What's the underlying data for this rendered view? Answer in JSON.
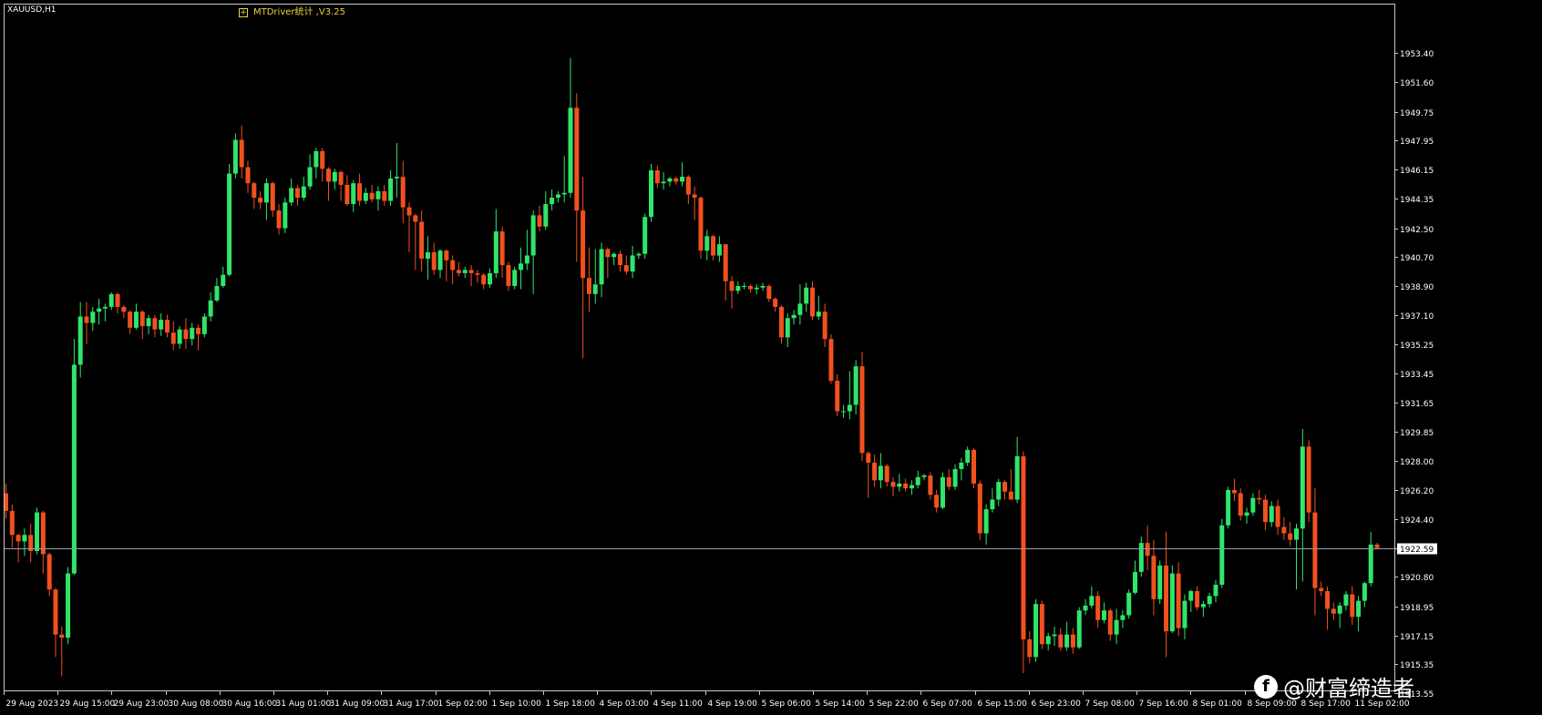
{
  "symbol_label": "XAUUSD,H1",
  "indicator_label": "MTDriver统计 ,V3.25",
  "indicator_toggle": "+",
  "watermark": {
    "logo": "f",
    "text": "@财富缔造者"
  },
  "colors": {
    "background": "#000000",
    "up": "#2fe66a",
    "down": "#f2501e",
    "price_line": "#8f9fb8",
    "frame": "#c8c8c8",
    "axis_text": "#ffffff"
  },
  "chart_data": {
    "type": "candlestick",
    "title": "XAUUSD,H1",
    "ylim": [
      1913.55,
      1954.95
    ],
    "y_ticks": [
      "1953.40",
      "1951.60",
      "1949.75",
      "1947.95",
      "1946.15",
      "1944.35",
      "1942.50",
      "1940.70",
      "1938.90",
      "1937.10",
      "1935.25",
      "1933.45",
      "1931.65",
      "1929.85",
      "1928.00",
      "1926.20",
      "1924.40",
      "1922.59",
      "1920.80",
      "1918.95",
      "1917.15",
      "1915.35",
      "1913.55"
    ],
    "x_ticks": [
      "29 Aug 2023",
      "29 Aug 15:00",
      "29 Aug 23:00",
      "30 Aug 08:00",
      "30 Aug 16:00",
      "31 Aug 01:00",
      "31 Aug 09:00",
      "31 Aug 17:00",
      "1 Sep 02:00",
      "1 Sep 10:00",
      "1 Sep 18:00",
      "4 Sep 03:00",
      "4 Sep 11:00",
      "4 Sep 19:00",
      "5 Sep 06:00",
      "5 Sep 14:00",
      "5 Sep 22:00",
      "6 Sep 07:00",
      "6 Sep 15:00",
      "6 Sep 23:00",
      "7 Sep 08:00",
      "7 Sep 16:00",
      "8 Sep 01:00",
      "8 Sep 09:00",
      "8 Sep 17:00",
      "11 Sep 02:00"
    ],
    "current_price": "1922.59",
    "grid": false,
    "ohlc": [
      [
        1926.0,
        1926.6,
        1924.4,
        1924.9
      ],
      [
        1924.9,
        1925.3,
        1922.6,
        1923.4
      ],
      [
        1923.4,
        1923.5,
        1921.7,
        1923.0
      ],
      [
        1923.0,
        1923.8,
        1922.1,
        1923.4
      ],
      [
        1923.4,
        1924.1,
        1921.7,
        1922.4
      ],
      [
        1922.4,
        1925.1,
        1922.2,
        1924.8
      ],
      [
        1924.8,
        1924.9,
        1921.0,
        1922.2
      ],
      [
        1922.2,
        1922.3,
        1919.6,
        1920.0
      ],
      [
        1920.0,
        1920.1,
        1915.8,
        1917.2
      ],
      [
        1917.2,
        1917.7,
        1914.6,
        1917.0
      ],
      [
        1917.0,
        1921.4,
        1916.6,
        1921.0
      ],
      [
        1921.0,
        1935.6,
        1920.9,
        1934.0
      ],
      [
        1934.0,
        1937.9,
        1933.2,
        1937.0
      ],
      [
        1937.0,
        1937.9,
        1935.3,
        1936.6
      ],
      [
        1936.6,
        1937.6,
        1936.1,
        1937.3
      ],
      [
        1937.3,
        1938.1,
        1936.5,
        1937.5
      ],
      [
        1937.5,
        1937.8,
        1936.7,
        1937.6
      ],
      [
        1937.6,
        1938.5,
        1937.4,
        1938.4
      ],
      [
        1938.4,
        1938.5,
        1937.2,
        1937.6
      ],
      [
        1937.6,
        1937.7,
        1936.9,
        1937.3
      ],
      [
        1937.3,
        1937.4,
        1935.9,
        1936.3
      ],
      [
        1936.3,
        1937.8,
        1936.2,
        1937.3
      ],
      [
        1937.3,
        1937.4,
        1935.6,
        1936.4
      ],
      [
        1936.4,
        1937.1,
        1935.9,
        1936.9
      ],
      [
        1936.9,
        1937.1,
        1935.7,
        1936.2
      ],
      [
        1936.2,
        1937.2,
        1935.8,
        1936.8
      ],
      [
        1936.8,
        1937.1,
        1935.7,
        1936.0
      ],
      [
        1936.0,
        1936.7,
        1934.9,
        1935.3
      ],
      [
        1935.3,
        1936.4,
        1935.0,
        1936.2
      ],
      [
        1936.2,
        1936.9,
        1935.0,
        1935.6
      ],
      [
        1935.6,
        1936.6,
        1935.2,
        1936.3
      ],
      [
        1936.3,
        1936.5,
        1934.9,
        1935.9
      ],
      [
        1935.9,
        1937.2,
        1935.7,
        1937.0
      ],
      [
        1937.0,
        1938.5,
        1936.7,
        1938.0
      ],
      [
        1938.0,
        1939.4,
        1937.9,
        1938.9
      ],
      [
        1938.9,
        1940.1,
        1938.8,
        1939.6
      ],
      [
        1939.6,
        1946.5,
        1939.5,
        1945.9
      ],
      [
        1945.9,
        1948.4,
        1945.6,
        1948.0
      ],
      [
        1948.0,
        1948.9,
        1945.6,
        1946.3
      ],
      [
        1946.3,
        1946.7,
        1944.7,
        1945.3
      ],
      [
        1945.3,
        1945.4,
        1943.7,
        1944.4
      ],
      [
        1944.4,
        1944.8,
        1943.7,
        1944.1
      ],
      [
        1944.1,
        1945.6,
        1943.0,
        1945.3
      ],
      [
        1945.3,
        1945.4,
        1943.2,
        1943.6
      ],
      [
        1943.6,
        1944.0,
        1942.1,
        1942.5
      ],
      [
        1942.5,
        1944.4,
        1942.2,
        1944.1
      ],
      [
        1944.1,
        1945.6,
        1943.9,
        1945.0
      ],
      [
        1945.0,
        1945.2,
        1943.9,
        1944.4
      ],
      [
        1944.4,
        1945.7,
        1944.2,
        1945.1
      ],
      [
        1945.1,
        1947.1,
        1944.9,
        1946.3
      ],
      [
        1946.3,
        1947.5,
        1945.6,
        1947.3
      ],
      [
        1947.3,
        1947.5,
        1945.4,
        1946.2
      ],
      [
        1946.2,
        1946.3,
        1944.2,
        1945.4
      ],
      [
        1945.4,
        1946.2,
        1944.9,
        1946.0
      ],
      [
        1946.0,
        1946.1,
        1944.2,
        1945.2
      ],
      [
        1945.2,
        1945.8,
        1943.9,
        1944.0
      ],
      [
        1944.0,
        1945.5,
        1943.5,
        1945.3
      ],
      [
        1945.3,
        1945.9,
        1943.9,
        1944.2
      ],
      [
        1944.2,
        1945.0,
        1944.0,
        1944.7
      ],
      [
        1944.7,
        1945.2,
        1944.1,
        1944.3
      ],
      [
        1944.3,
        1945.1,
        1943.6,
        1944.8
      ],
      [
        1944.8,
        1945.2,
        1943.9,
        1944.2
      ],
      [
        1944.2,
        1946.1,
        1943.9,
        1945.6
      ],
      [
        1945.6,
        1947.8,
        1944.4,
        1945.7
      ],
      [
        1945.7,
        1946.7,
        1942.8,
        1943.8
      ],
      [
        1943.8,
        1944.1,
        1941.0,
        1943.3
      ],
      [
        1943.3,
        1943.4,
        1939.9,
        1942.9
      ],
      [
        1942.9,
        1943.6,
        1939.8,
        1940.6
      ],
      [
        1940.6,
        1942.0,
        1939.3,
        1941.0
      ],
      [
        1941.0,
        1941.6,
        1939.6,
        1939.9
      ],
      [
        1939.9,
        1941.2,
        1939.4,
        1941.1
      ],
      [
        1941.1,
        1941.2,
        1939.2,
        1940.5
      ],
      [
        1940.5,
        1940.8,
        1939.0,
        1939.9
      ],
      [
        1939.9,
        1940.4,
        1939.5,
        1939.7
      ],
      [
        1939.7,
        1940.1,
        1939.4,
        1939.9
      ],
      [
        1939.9,
        1940.2,
        1938.9,
        1939.7
      ],
      [
        1939.7,
        1939.9,
        1939.1,
        1939.6
      ],
      [
        1939.6,
        1939.7,
        1938.7,
        1939.0
      ],
      [
        1939.0,
        1940.0,
        1938.8,
        1939.7
      ],
      [
        1939.7,
        1943.7,
        1939.4,
        1942.3
      ],
      [
        1942.3,
        1942.6,
        1939.4,
        1940.2
      ],
      [
        1940.2,
        1940.4,
        1938.6,
        1938.9
      ],
      [
        1938.9,
        1940.1,
        1938.7,
        1939.9
      ],
      [
        1939.9,
        1941.3,
        1938.7,
        1940.3
      ],
      [
        1940.3,
        1942.4,
        1939.9,
        1940.8
      ],
      [
        1940.8,
        1943.6,
        1938.4,
        1943.3
      ],
      [
        1943.3,
        1943.9,
        1942.3,
        1942.6
      ],
      [
        1942.6,
        1944.8,
        1942.4,
        1944.0
      ],
      [
        1944.0,
        1944.9,
        1943.6,
        1944.4
      ],
      [
        1944.4,
        1944.8,
        1944.1,
        1944.6
      ],
      [
        1944.6,
        1947.0,
        1944.1,
        1944.7
      ],
      [
        1944.7,
        1953.1,
        1944.4,
        1950.0
      ],
      [
        1950.0,
        1950.9,
        1940.4,
        1943.6
      ],
      [
        1943.6,
        1945.7,
        1934.4,
        1939.4
      ],
      [
        1939.4,
        1941.3,
        1937.3,
        1938.4
      ],
      [
        1938.4,
        1941.2,
        1937.8,
        1939.0
      ],
      [
        1939.0,
        1941.6,
        1938.2,
        1941.2
      ],
      [
        1941.2,
        1941.3,
        1939.4,
        1940.7
      ],
      [
        1940.7,
        1941.0,
        1940.2,
        1940.9
      ],
      [
        1940.9,
        1941.1,
        1939.8,
        1940.2
      ],
      [
        1940.2,
        1940.8,
        1939.6,
        1939.8
      ],
      [
        1939.8,
        1941.4,
        1939.4,
        1940.8
      ],
      [
        1940.8,
        1941.0,
        1940.6,
        1940.9
      ],
      [
        1940.9,
        1943.4,
        1940.6,
        1943.2
      ],
      [
        1943.2,
        1946.5,
        1942.9,
        1946.1
      ],
      [
        1946.1,
        1946.4,
        1945.0,
        1945.3
      ],
      [
        1945.3,
        1946.0,
        1944.9,
        1945.4
      ],
      [
        1945.4,
        1945.7,
        1945.1,
        1945.6
      ],
      [
        1945.6,
        1945.7,
        1945.2,
        1945.4
      ],
      [
        1945.4,
        1946.6,
        1945.1,
        1945.7
      ],
      [
        1945.7,
        1945.8,
        1944.0,
        1944.6
      ],
      [
        1944.6,
        1945.1,
        1943.0,
        1944.4
      ],
      [
        1944.4,
        1944.5,
        1940.6,
        1941.1
      ],
      [
        1941.1,
        1942.4,
        1940.5,
        1942.0
      ],
      [
        1942.0,
        1942.1,
        1940.5,
        1940.8
      ],
      [
        1940.8,
        1942.0,
        1940.4,
        1941.5
      ],
      [
        1941.5,
        1941.5,
        1938.0,
        1939.2
      ],
      [
        1939.2,
        1939.5,
        1937.5,
        1938.6
      ],
      [
        1938.6,
        1939.2,
        1938.4,
        1938.9
      ],
      [
        1938.9,
        1939.1,
        1938.7,
        1938.9
      ],
      [
        1938.9,
        1939.0,
        1938.5,
        1938.7
      ],
      [
        1938.7,
        1939.0,
        1938.4,
        1938.8
      ],
      [
        1938.8,
        1939.1,
        1938.6,
        1938.9
      ],
      [
        1938.9,
        1939.0,
        1937.9,
        1938.1
      ],
      [
        1938.1,
        1938.2,
        1937.3,
        1937.6
      ],
      [
        1937.6,
        1937.7,
        1935.3,
        1935.7
      ],
      [
        1935.7,
        1937.2,
        1935.1,
        1936.9
      ],
      [
        1936.9,
        1937.4,
        1936.5,
        1937.1
      ],
      [
        1937.1,
        1939.0,
        1936.5,
        1937.8
      ],
      [
        1937.8,
        1939.1,
        1937.3,
        1938.8
      ],
      [
        1938.8,
        1939.2,
        1936.8,
        1937.0
      ],
      [
        1937.0,
        1938.3,
        1936.8,
        1937.3
      ],
      [
        1937.3,
        1937.8,
        1935.1,
        1935.6
      ],
      [
        1935.6,
        1935.9,
        1932.8,
        1933.0
      ],
      [
        1933.0,
        1933.4,
        1930.8,
        1931.1
      ],
      [
        1931.1,
        1931.5,
        1930.7,
        1931.1
      ],
      [
        1931.1,
        1933.6,
        1930.6,
        1931.5
      ],
      [
        1931.5,
        1934.3,
        1930.9,
        1933.9
      ],
      [
        1933.9,
        1934.8,
        1928.0,
        1928.5
      ],
      [
        1928.5,
        1928.6,
        1925.7,
        1927.9
      ],
      [
        1927.9,
        1928.4,
        1926.4,
        1926.8
      ],
      [
        1926.8,
        1928.5,
        1926.3,
        1927.7
      ],
      [
        1927.7,
        1927.8,
        1926.4,
        1926.7
      ],
      [
        1926.7,
        1927.0,
        1925.8,
        1926.4
      ],
      [
        1926.4,
        1927.2,
        1926.1,
        1926.6
      ],
      [
        1926.6,
        1926.9,
        1926.1,
        1926.3
      ],
      [
        1926.3,
        1926.8,
        1925.9,
        1926.5
      ],
      [
        1926.5,
        1927.4,
        1926.3,
        1927.0
      ],
      [
        1927.0,
        1927.2,
        1926.8,
        1927.1
      ],
      [
        1927.1,
        1927.3,
        1925.6,
        1925.9
      ],
      [
        1925.9,
        1926.2,
        1924.8,
        1925.1
      ],
      [
        1925.1,
        1927.3,
        1925.0,
        1927.0
      ],
      [
        1927.0,
        1927.5,
        1926.2,
        1926.4
      ],
      [
        1926.4,
        1927.8,
        1926.2,
        1927.5
      ],
      [
        1927.5,
        1928.2,
        1926.8,
        1927.9
      ],
      [
        1927.9,
        1928.9,
        1927.7,
        1928.7
      ],
      [
        1928.7,
        1928.8,
        1926.3,
        1926.6
      ],
      [
        1926.6,
        1926.8,
        1923.1,
        1923.5
      ],
      [
        1923.5,
        1925.3,
        1922.8,
        1925.0
      ],
      [
        1925.0,
        1926.3,
        1924.8,
        1925.6
      ],
      [
        1925.6,
        1926.9,
        1925.2,
        1926.7
      ],
      [
        1926.7,
        1926.8,
        1925.6,
        1926.1
      ],
      [
        1926.1,
        1927.5,
        1925.9,
        1925.6
      ],
      [
        1925.6,
        1929.5,
        1925.4,
        1928.3
      ],
      [
        1928.3,
        1928.6,
        1914.8,
        1916.9
      ],
      [
        1916.9,
        1917.4,
        1915.4,
        1915.8
      ],
      [
        1915.8,
        1919.4,
        1915.5,
        1919.1
      ],
      [
        1919.1,
        1919.3,
        1916.3,
        1916.6
      ],
      [
        1916.6,
        1917.3,
        1916.2,
        1917.1
      ],
      [
        1917.1,
        1917.7,
        1916.5,
        1917.2
      ],
      [
        1917.2,
        1917.6,
        1916.2,
        1916.4
      ],
      [
        1916.4,
        1918.0,
        1916.2,
        1917.2
      ],
      [
        1917.2,
        1917.6,
        1916.0,
        1916.4
      ],
      [
        1916.4,
        1918.9,
        1916.3,
        1918.7
      ],
      [
        1918.7,
        1919.4,
        1918.4,
        1919.0
      ],
      [
        1919.0,
        1920.2,
        1918.8,
        1919.6
      ],
      [
        1919.6,
        1919.9,
        1917.6,
        1918.1
      ],
      [
        1918.1,
        1919.2,
        1917.9,
        1918.7
      ],
      [
        1918.7,
        1918.8,
        1916.8,
        1917.2
      ],
      [
        1917.2,
        1918.8,
        1916.6,
        1918.1
      ],
      [
        1918.1,
        1918.7,
        1917.6,
        1918.4
      ],
      [
        1918.4,
        1920.0,
        1918.2,
        1919.8
      ],
      [
        1919.8,
        1921.8,
        1919.7,
        1921.1
      ],
      [
        1921.1,
        1923.3,
        1920.8,
        1922.9
      ],
      [
        1922.9,
        1924.0,
        1921.2,
        1922.1
      ],
      [
        1922.1,
        1923.1,
        1918.4,
        1919.4
      ],
      [
        1919.4,
        1921.8,
        1919.1,
        1921.5
      ],
      [
        1921.5,
        1923.6,
        1915.8,
        1917.4
      ],
      [
        1917.4,
        1921.5,
        1917.3,
        1921.0
      ],
      [
        1921.0,
        1921.7,
        1917.1,
        1917.6
      ],
      [
        1917.6,
        1919.7,
        1916.9,
        1919.3
      ],
      [
        1919.3,
        1920.0,
        1918.6,
        1919.9
      ],
      [
        1919.9,
        1920.2,
        1918.7,
        1918.9
      ],
      [
        1918.9,
        1919.3,
        1918.3,
        1919.1
      ],
      [
        1919.1,
        1919.8,
        1918.9,
        1919.6
      ],
      [
        1919.6,
        1920.6,
        1919.2,
        1920.3
      ],
      [
        1920.3,
        1924.4,
        1920.1,
        1924.0
      ],
      [
        1924.0,
        1926.4,
        1923.8,
        1926.2
      ],
      [
        1926.2,
        1926.9,
        1925.5,
        1926.0
      ],
      [
        1926.0,
        1926.3,
        1924.3,
        1924.6
      ],
      [
        1924.6,
        1925.1,
        1924.1,
        1924.8
      ],
      [
        1924.8,
        1926.0,
        1924.6,
        1925.7
      ],
      [
        1925.7,
        1926.2,
        1925.3,
        1925.6
      ],
      [
        1925.6,
        1925.9,
        1923.7,
        1924.2
      ],
      [
        1924.2,
        1925.5,
        1923.9,
        1925.2
      ],
      [
        1925.2,
        1925.6,
        1923.4,
        1923.9
      ],
      [
        1923.9,
        1924.5,
        1923.1,
        1923.5
      ],
      [
        1923.5,
        1924.2,
        1922.7,
        1923.1
      ],
      [
        1923.1,
        1924.1,
        1920.0,
        1923.8
      ],
      [
        1923.8,
        1930.0,
        1920.5,
        1928.9
      ],
      [
        1928.9,
        1929.3,
        1924.2,
        1924.8
      ],
      [
        1924.8,
        1926.3,
        1918.4,
        1920.1
      ],
      [
        1920.1,
        1920.5,
        1919.6,
        1919.9
      ],
      [
        1919.9,
        1920.2,
        1917.5,
        1918.8
      ],
      [
        1918.8,
        1919.2,
        1918.1,
        1918.5
      ],
      [
        1918.5,
        1919.2,
        1917.6,
        1919.0
      ],
      [
        1919.0,
        1919.9,
        1918.7,
        1919.7
      ],
      [
        1919.7,
        1920.2,
        1917.8,
        1918.3
      ],
      [
        1918.3,
        1919.6,
        1917.4,
        1919.3
      ],
      [
        1919.3,
        1920.5,
        1918.9,
        1920.4
      ],
      [
        1920.4,
        1923.6,
        1920.2,
        1922.8
      ],
      [
        1922.8,
        1922.9,
        1922.5,
        1922.59
      ]
    ]
  }
}
